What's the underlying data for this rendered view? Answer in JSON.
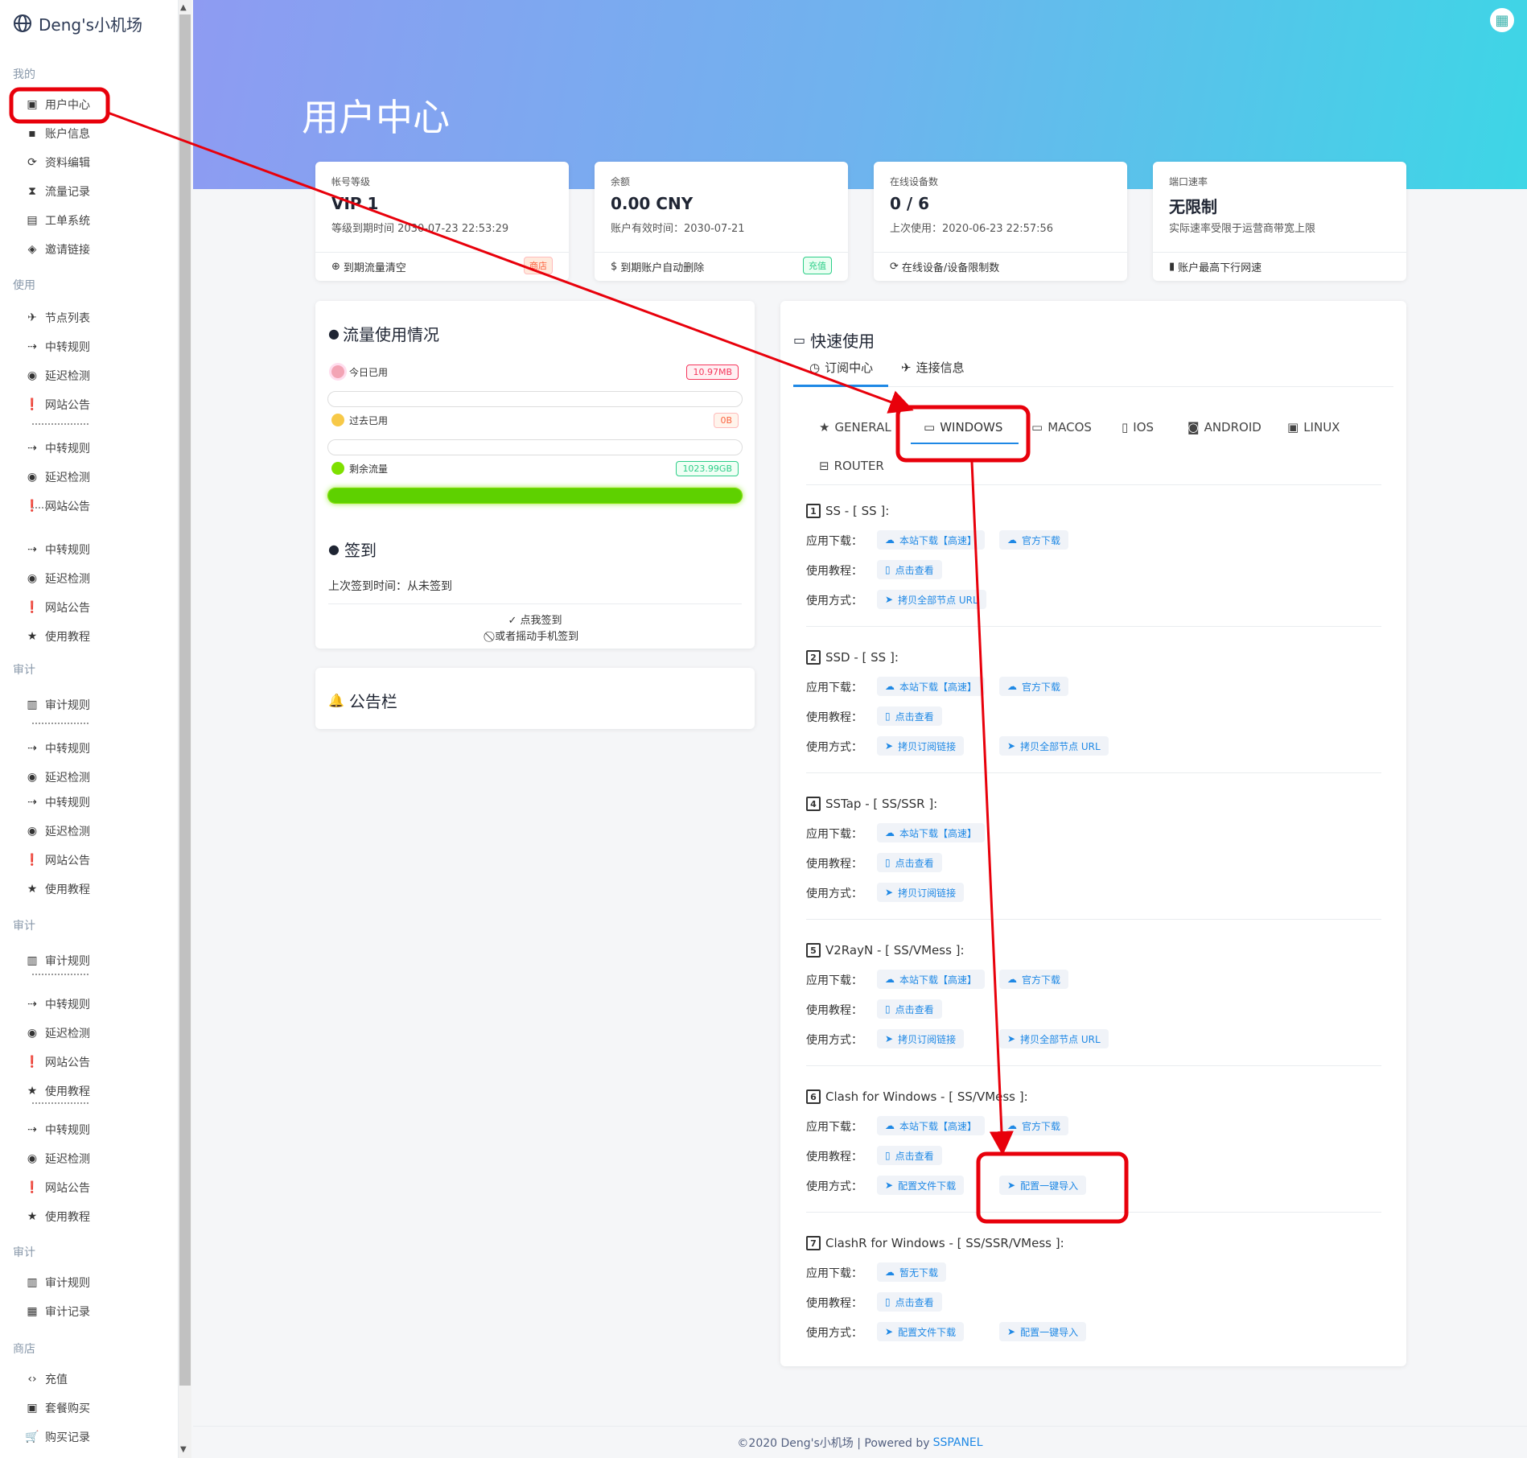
{
  "brand": {
    "title": "Deng's小机场"
  },
  "sidebar": {
    "sections": [
      {
        "title": "我的",
        "items": [
          "用户中心",
          "账户信息",
          "资料编辑",
          "流量记录",
          "工单系统",
          "邀请链接"
        ]
      },
      {
        "title": "使用",
        "items": [
          "节点列表",
          "中转规则",
          "延迟检测",
          "网站公告",
          "中转规则",
          "延迟检测",
          "网站公告",
          "中转规则",
          "延迟检测",
          "网站公告",
          "使用教程"
        ]
      },
      {
        "title": "审计",
        "items": [
          "审计规则",
          "中转规则",
          "延迟检测",
          "中转规则",
          "延迟检测",
          "网站公告",
          "使用教程"
        ]
      },
      {
        "title": "审计",
        "items": [
          "审计规则",
          "中转规则",
          "延迟检测",
          "网站公告",
          "使用教程",
          "中转规则",
          "延迟检测",
          "网站公告",
          "使用教程"
        ]
      },
      {
        "title": "审计",
        "items": [
          "审计规则",
          "审计记录"
        ]
      },
      {
        "title": "商店",
        "items": [
          "充值",
          "套餐购买",
          "购买记录"
        ]
      }
    ]
  },
  "header": {
    "title": "用户中心"
  },
  "stats": [
    {
      "label": "帐号等级",
      "value": "VIP 1",
      "sub": "等级到期时间 2030-07-23 22:53:29",
      "foot": "到期流量清空",
      "badge": "商店"
    },
    {
      "label": "余额",
      "value": "0.00 CNY",
      "sub": "账户有效时间：2030-07-21",
      "foot": "到期账户自动删除",
      "badge": "充值"
    },
    {
      "label": "在线设备数",
      "value": "0 / 6",
      "sub": "上次使用：2020-06-23 22:57:56",
      "foot": "在线设备/设备限制数",
      "badge": ""
    },
    {
      "label": "端口速率",
      "value": "无限制",
      "sub": "实际速率受限于运营商带宽上限",
      "foot": "账户最高下行网速",
      "badge": ""
    }
  ],
  "traffic": {
    "title": "流量使用情况",
    "today_label": "今日已用",
    "today_value": "10.97MB",
    "past_label": "过去已用",
    "past_value": "0B",
    "remain_label": "剩余流量",
    "remain_value": "1023.99GB",
    "remain_fraction": 1.0
  },
  "checkin": {
    "title": "签到",
    "last": "上次签到时间：从未签到",
    "button": "点我签到",
    "shake": "或者摇动手机签到"
  },
  "notice": {
    "title": "公告栏"
  },
  "quick": {
    "title": "快速使用",
    "subtabs": [
      "订阅中心",
      "连接信息"
    ],
    "os_tabs": [
      "GENERAL",
      "WINDOWS",
      "MACOS",
      "IOS",
      "ANDROID",
      "LINUX",
      "ROUTER"
    ],
    "active_os": "WINDOWS",
    "row_labels": {
      "download": "应用下载：",
      "tutorial": "使用教程：",
      "usage": "使用方式："
    },
    "clients": [
      {
        "num": "1",
        "title": "SS - [ SS ]:",
        "download": [
          "本站下载【高速】",
          "官方下载"
        ],
        "tutorial": "点击查看",
        "usage": [
          "拷贝全部节点 URL"
        ]
      },
      {
        "num": "2",
        "title": "SSD - [ SS ]:",
        "download": [
          "本站下载【高速】",
          "官方下载"
        ],
        "tutorial": "点击查看",
        "usage": [
          "拷贝订阅链接",
          "拷贝全部节点 URL"
        ]
      },
      {
        "num": "4",
        "title": "SSTap - [ SS/SSR ]:",
        "download": [
          "本站下载【高速】"
        ],
        "tutorial": "点击查看",
        "usage": [
          "拷贝订阅链接"
        ]
      },
      {
        "num": "5",
        "title": "V2RayN - [ SS/VMess ]:",
        "download": [
          "本站下载【高速】",
          "官方下载"
        ],
        "tutorial": "点击查看",
        "usage": [
          "拷贝订阅链接",
          "拷贝全部节点 URL"
        ]
      },
      {
        "num": "6",
        "title": "Clash for Windows - [ SS/VMess ]:",
        "download": [
          "本站下载【高速】",
          "官方下载"
        ],
        "tutorial": "点击查看",
        "usage": [
          "配置文件下载",
          "配置一键导入"
        ]
      },
      {
        "num": "7",
        "title": "ClashR for Windows - [ SS/SSR/VMess ]:",
        "download": [
          "暂无下载"
        ],
        "tutorial": "点击查看",
        "usage": [
          "配置文件下载",
          "配置一键导入"
        ]
      }
    ]
  },
  "footer": {
    "text": "©2020 Deng's小机场 | Powered by",
    "link": "SSPANEL"
  },
  "colors": {
    "annotation": "#e8000b",
    "accent": "#1e88e5",
    "hero_start": "#8e9bf2",
    "hero_end": "#3dd6e6"
  }
}
